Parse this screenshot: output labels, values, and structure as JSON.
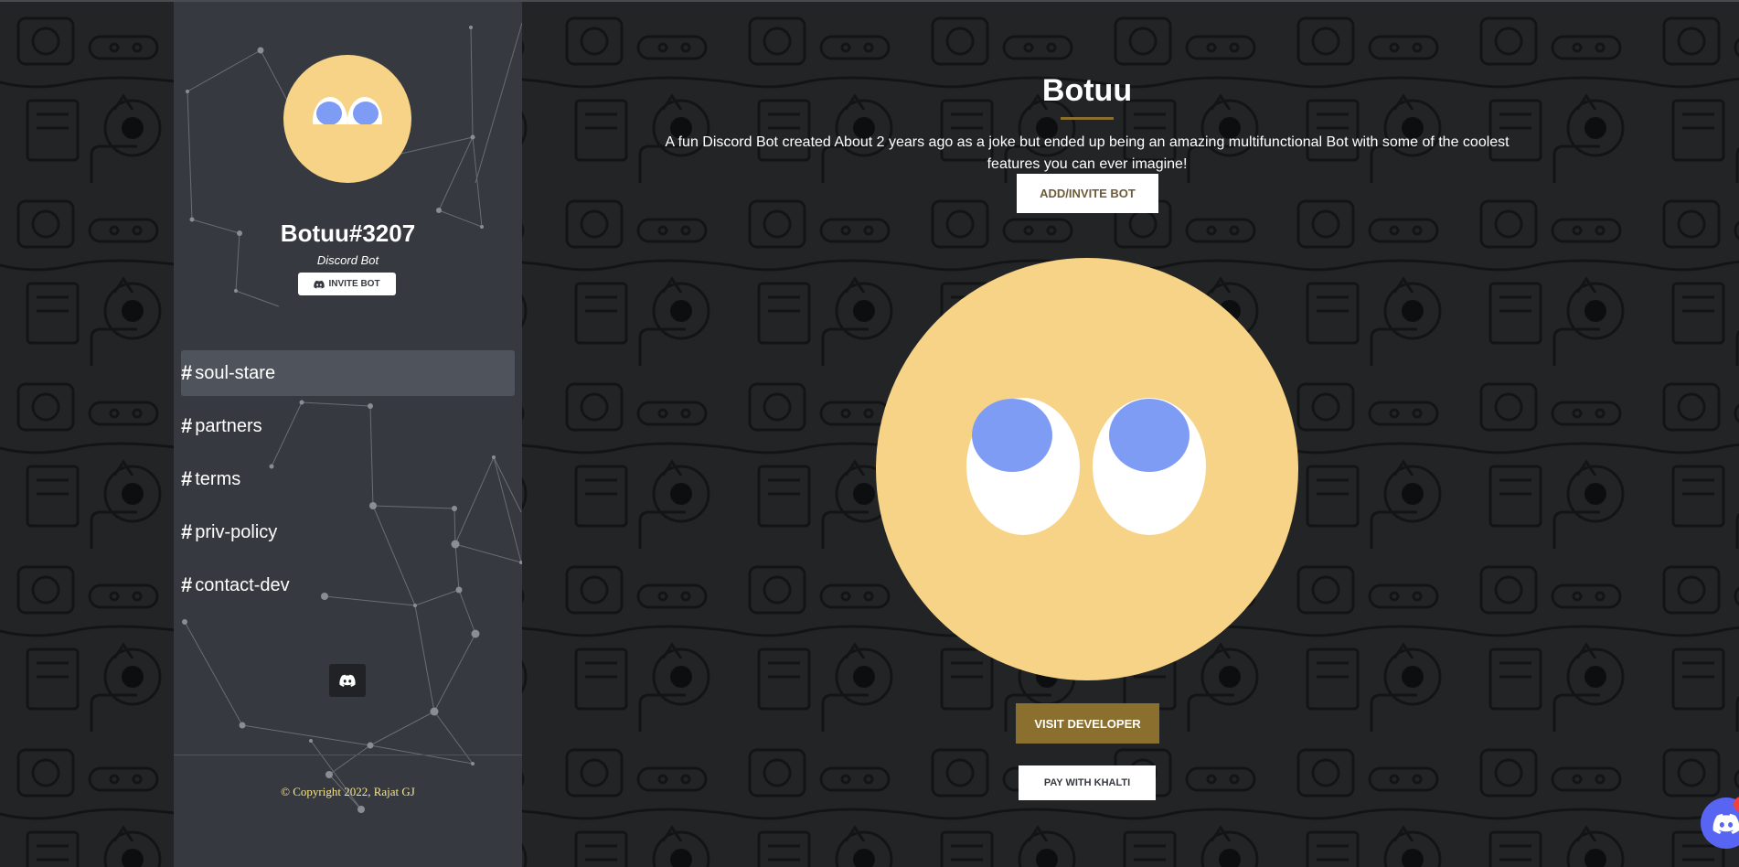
{
  "sidebar": {
    "bot_name": "Botuu#3207",
    "bot_subtitle": "Discord Bot",
    "invite_label": "INVITE BOT",
    "nav": [
      {
        "label": "soul-stare",
        "active": true
      },
      {
        "label": "partners",
        "active": false
      },
      {
        "label": "terms",
        "active": false
      },
      {
        "label": "priv-policy",
        "active": false
      },
      {
        "label": "contact-dev",
        "active": false
      }
    ],
    "copyright": "Copyright 2022, Rajat GJ"
  },
  "main": {
    "title": "Botuu",
    "description": "A fun Discord Bot created About 2 years ago as a joke but ended up being an amazing multifunctional Bot with some of the coolest features you can ever imagine!",
    "add_button": "ADD/INVITE BOT",
    "visit_button": "VISIT DEVELOPER",
    "pay_button": "PAY WITH KHALTI"
  },
  "widget": {
    "badge_count": "1"
  },
  "icons": {
    "avatar": "rolling-eyes-face-icon",
    "discord": "discord-icon",
    "copyright": "copyright-icon"
  },
  "colors": {
    "background": "#232426",
    "sidebar": "#36393f",
    "active_nav": "#4f545c",
    "accent_gold": "#8b6f2f",
    "avatar_yellow": "#f6d386",
    "eye_blue": "#7f9cf5",
    "discord_blurple": "#5865f2",
    "badge_red": "#ed4245"
  }
}
